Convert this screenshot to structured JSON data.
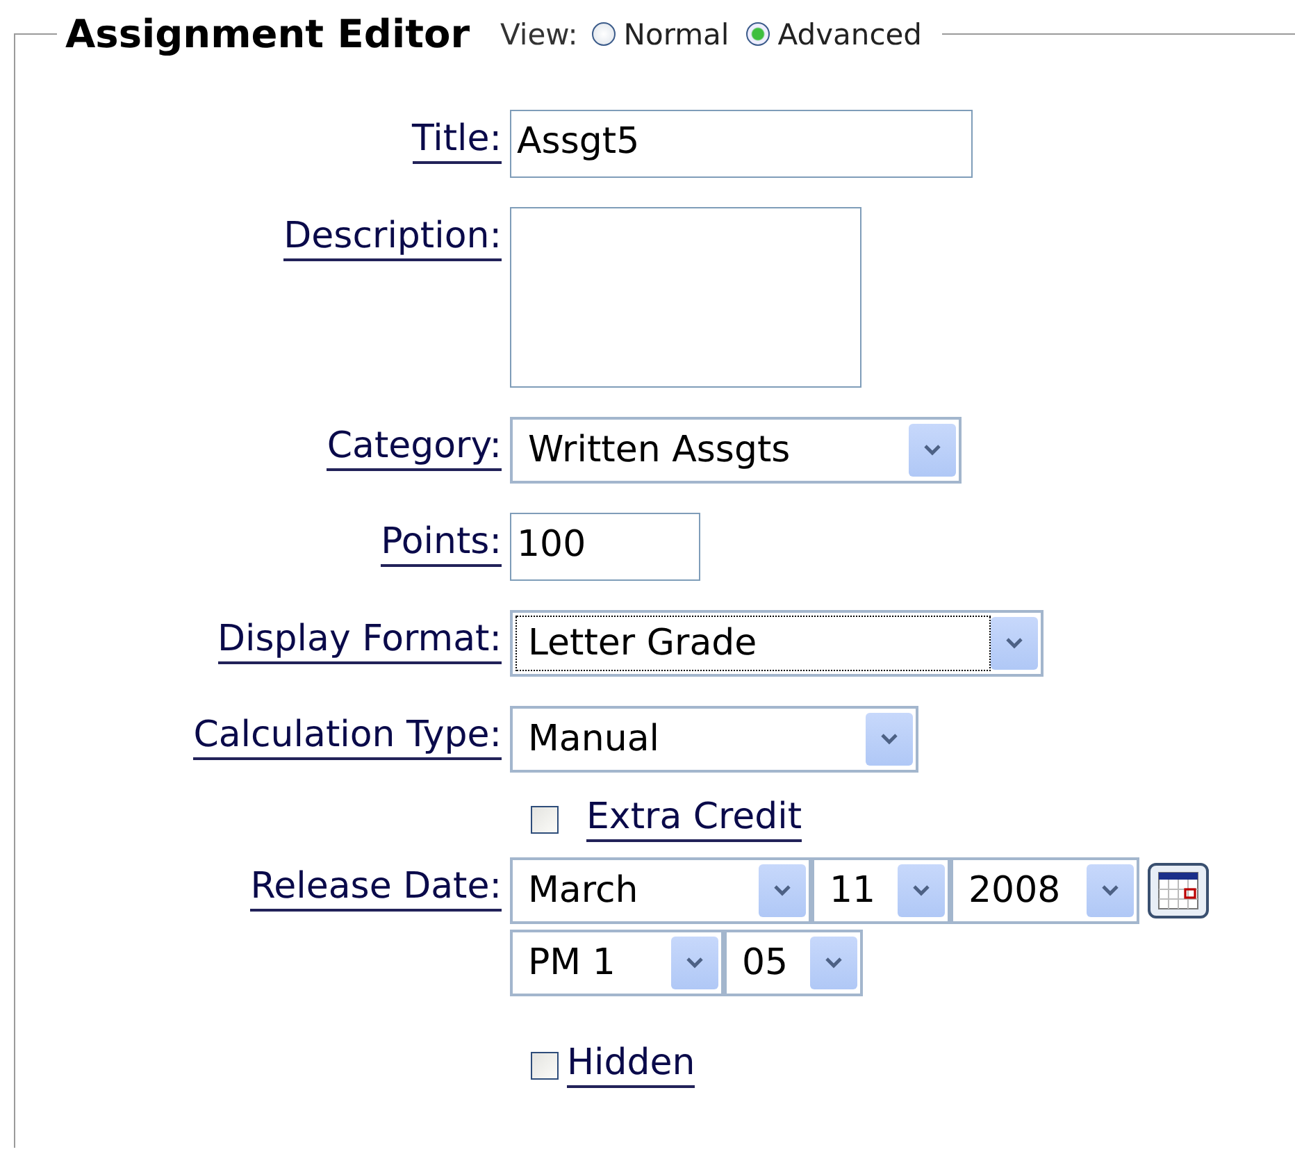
{
  "legend": {
    "title": "Assignment Editor",
    "view_label": "View:",
    "view_options": [
      {
        "label": "Normal",
        "selected": false
      },
      {
        "label": "Advanced",
        "selected": true
      }
    ]
  },
  "fields": [
    {
      "kind": "text",
      "label": "Title:",
      "value": "Assgt5"
    },
    {
      "kind": "textarea",
      "label": "Description:"
    },
    {
      "kind": "select",
      "label": "Category:",
      "value": "Written Assgts",
      "focused": false
    },
    {
      "kind": "number",
      "label": "Points:",
      "value": "100"
    },
    {
      "kind": "select",
      "label": "Display Format:",
      "value": "Letter Grade",
      "focused": true
    },
    {
      "kind": "select",
      "label": "Calculation Type:",
      "value": "Manual",
      "focused": false
    },
    {
      "kind": "checkbox",
      "label": "Extra Credit",
      "checked": false
    },
    {
      "kind": "date",
      "label": "Release Date:",
      "date": [
        "March",
        "11",
        "2008"
      ],
      "time": [
        "PM 1",
        "05"
      ]
    },
    {
      "kind": "checkbox",
      "label": "Hidden",
      "checked": false
    }
  ]
}
